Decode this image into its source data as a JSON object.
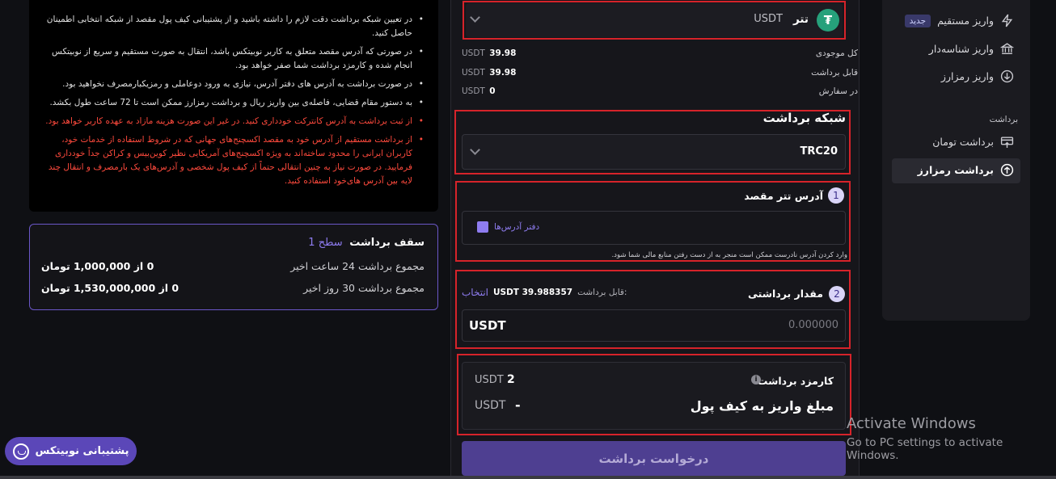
{
  "info": {
    "items": [
      {
        "text": "در تعیین شبکه برداشت دقت لازم را داشته باشید و از پشتیبانی کیف پول مقصد از شبکه انتخابی اطمینان حاصل کنید.",
        "warn": false
      },
      {
        "text": "در صورتی که آدرس مقصد متعلق به کاربر نوبیتکس باشد، انتقال به صورت مستقیم و سریع از نوبیتکس انجام شده و کارمزد برداشت شما صفر خواهد بود.",
        "warn": false
      },
      {
        "text": "در صورت برداشت به آدرس های دفتر آدرس، نیازی به ورود دوعاملی و رمزیکبارمصرف نخواهید بود.",
        "warn": false
      },
      {
        "text": "به دستور مقام قضایی، فاصله‌ی بین واریز ریال و برداشت رمزارز ممکن است تا 72 ساعت طول بکشد.",
        "warn": false
      },
      {
        "text": "از ثبت برداشت به آدرس کانترکت خودداری کنید. در غیر این صورت هزینه مازاد به عهده کاربر خواهد بود.",
        "warn": true
      },
      {
        "text": "از برداشت مستقیم از آدرس خود به مقصد اکسچنج‌های جهانی که در شروط استفاده از خدمات خود، کاربران ایرانی را محدود ساخته‌اند به ویژه اکسچنج‌های آمریکایی نظیر کوین‌بیس و کراکن جداً خودداری فرمایید. در صورت نیاز به چنین انتقالی حتماً از کیف پول شخصی و آدرس‌های یک بارمصرف و انتقال چند لایه بین آدرس های‌خود استفاده کنید.",
        "warn": true
      }
    ]
  },
  "limits": {
    "title": "سقف برداشت",
    "level": "سطح 1",
    "rows": [
      {
        "label": "مجموع برداشت 24 ساعت اخیر",
        "value": "0 از 1,000,000 تومان"
      },
      {
        "label": "مجموع برداشت 30 روز اخیر",
        "value": "0 از 1,530,000,000 تومان"
      }
    ]
  },
  "support": {
    "label": "پشتیبانی نوبیتکس"
  },
  "coin": {
    "name": "تتر",
    "symbol": "USDT",
    "icon": "tether-icon",
    "color": "#26a17b"
  },
  "balances": [
    {
      "label": "کل موجودی",
      "value": "39.98",
      "unit": "USDT"
    },
    {
      "label": "قابل برداشت",
      "value": "39.98",
      "unit": "USDT"
    },
    {
      "label": "در سفارش",
      "value": "0",
      "unit": "USDT"
    }
  ],
  "network": {
    "title": "شبکه برداشت",
    "value": "TRC20"
  },
  "address": {
    "step": "1",
    "title": "آدرس تتر مقصد",
    "book_label": "دفتر آدرس‌ها",
    "warning": "وارد کردن آدرس نادرست ممکن است منجر به از دست رفتن منابع مالی شما شود."
  },
  "amount": {
    "step": "2",
    "title": "مقدار برداشتی",
    "available_label": "قابل برداشت:",
    "available_value": "USDT 39.988357",
    "select_label": "انتخاب",
    "placeholder": "0.000000",
    "unit": "USDT"
  },
  "fee": {
    "label": "کارمزد برداشت",
    "value": "2",
    "unit": "USDT",
    "receive_label": "مبلغ واریز به کیف پول",
    "receive_value": "-",
    "receive_unit": "USDT"
  },
  "submit": {
    "label": "درخواست برداشت"
  },
  "sidebar": {
    "items": [
      {
        "label": "واریز مستقیم",
        "badge": "جدید",
        "icon": "bolt-icon"
      },
      {
        "label": "واریز شناسه‌دار",
        "icon": "bank-icon"
      },
      {
        "label": "واریز رمزارز",
        "icon": "download-circle-icon"
      }
    ],
    "section": "برداشت",
    "withdraw_items": [
      {
        "label": "برداشت تومان",
        "icon": "card-out-icon"
      },
      {
        "label": "برداشت رمزارز",
        "icon": "upload-circle-icon",
        "active": true
      }
    ]
  },
  "watermark": {
    "line1": "Activate Windows",
    "line2": "Go to PC settings to activate Windows."
  },
  "colors": {
    "accent": "#5b47b8",
    "highlight": "#d6232a",
    "warn": "#ff4a3d"
  }
}
